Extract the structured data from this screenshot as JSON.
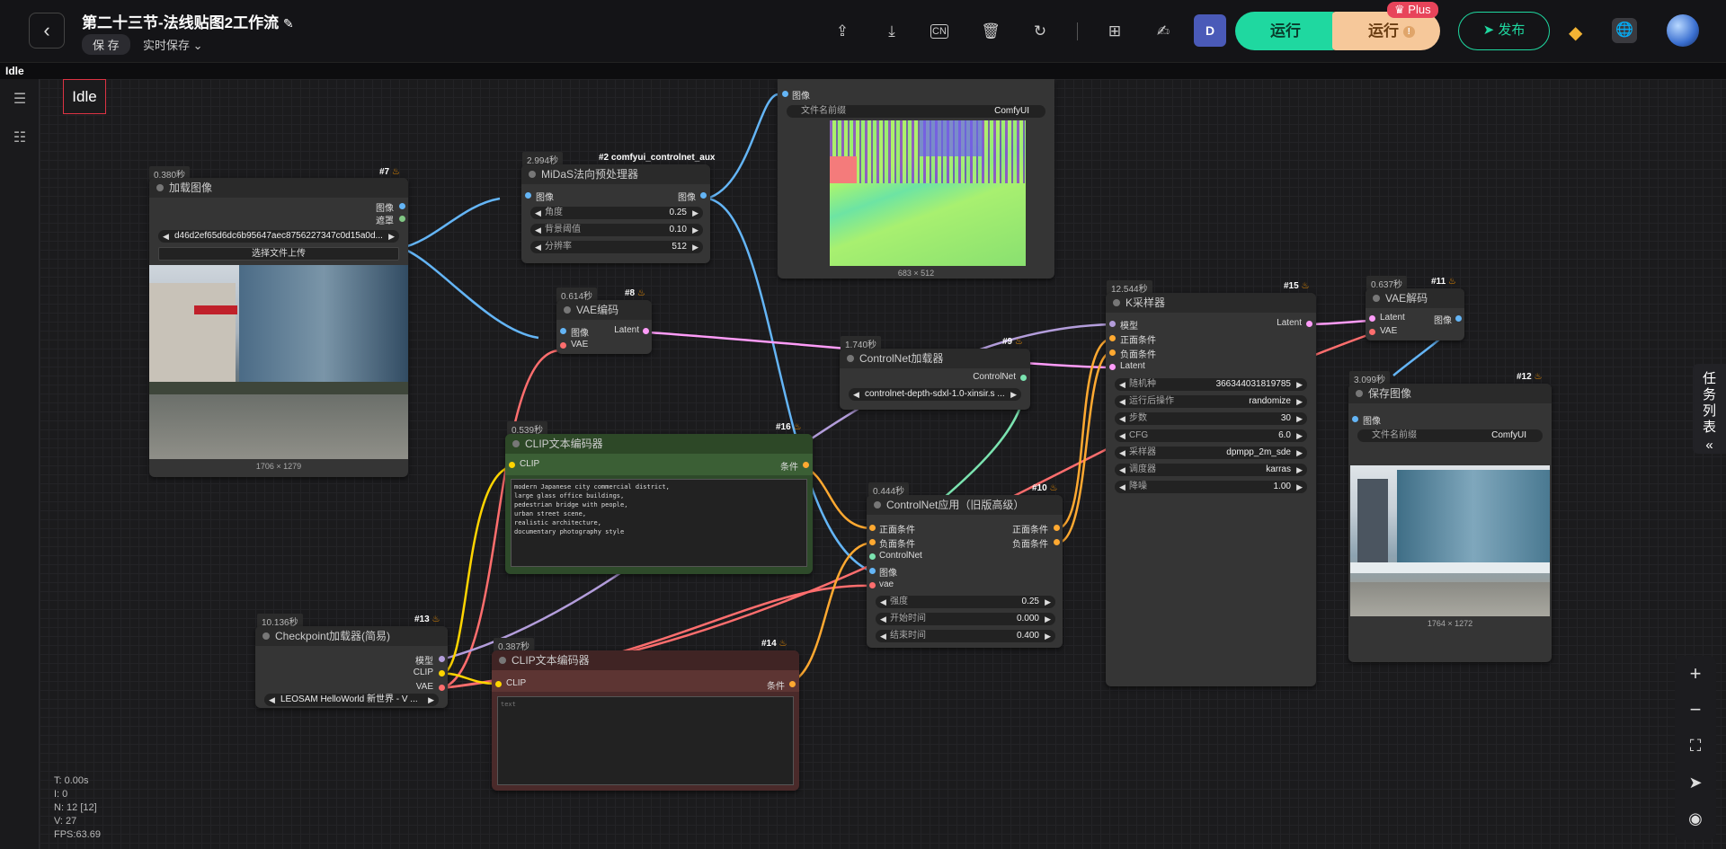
{
  "topbar": {
    "back_icon": "chevron-left-icon",
    "title": "第二十三节-法线贴图2工作流",
    "save_label": "保 存",
    "autosave_label": "实时保存",
    "run_label": "运行",
    "run_plus_label": "运行",
    "plus_badge": "Plus",
    "publish_label": "发布",
    "discord_label": "D"
  },
  "status_label": "Idle",
  "idle_box": "Idle",
  "right_tab": {
    "label": "任务列表",
    "icon": "double-chevron-left-icon"
  },
  "stats": {
    "t": "T: 0.00s",
    "i": "I: 0",
    "n": "N: 12 [12]",
    "v": "V: 27",
    "fps": "FPS:63.69"
  },
  "nodes": {
    "load_image": {
      "time": "0.380秒",
      "id": "#7",
      "title": "加载图像",
      "out_image": "图像",
      "out_mask": "遮罩",
      "filename": "d46d2ef65d6dc6b95647aec8756227347c0d15a0d...",
      "upload": "选择文件上传",
      "caption": "1706 × 1279"
    },
    "midas": {
      "time": "2.994秒",
      "id": "#2 comfyui_controlnet_aux",
      "title": "MiDaS法向预处理器",
      "in_image": "图像",
      "out_image": "图像",
      "widgets": [
        {
          "label": "角度",
          "value": "0.25"
        },
        {
          "label": "背景阈值",
          "value": "0.10"
        },
        {
          "label": "分辨率",
          "value": "512"
        }
      ]
    },
    "preview": {
      "in_image": "图像",
      "prefix_label": "文件名前缀",
      "prefix_value": "ComfyUI",
      "caption": "683 × 512"
    },
    "vae_encode": {
      "time": "0.614秒",
      "id": "#8",
      "title": "VAE编码",
      "in_image": "图像",
      "in_vae": "VAE",
      "out_latent": "Latent"
    },
    "controlnet_loader": {
      "time": "1.740秒",
      "id": "#9",
      "title": "ControlNet加载器",
      "out": "ControlNet",
      "model": "controlnet-depth-sdxl-1.0-xinsir.s ..."
    },
    "clip_pos": {
      "time": "0.539秒",
      "id": "#16",
      "title": "CLIP文本编码器",
      "in_clip": "CLIP",
      "out": "条件",
      "text": "modern Japanese city commercial district,\nlarge glass office buildings,\npedestrian bridge with people,\nurban street scene,\nrealistic architecture,\ndocumentary photography style"
    },
    "checkpoint": {
      "time": "10.136秒",
      "id": "#13",
      "title": "Checkpoint加载器(简易)",
      "out_model": "模型",
      "out_clip": "CLIP",
      "out_vae": "VAE",
      "ckpt": "LEOSAM HelloWorld 新世界 - V ..."
    },
    "clip_neg": {
      "time": "0.387秒",
      "id": "#14",
      "title": "CLIP文本编码器",
      "in_clip": "CLIP",
      "out": "条件",
      "text": "text"
    },
    "controlnet_apply": {
      "time": "0.444秒",
      "id": "#10",
      "title": "ControlNet应用（旧版高级）",
      "in_pos": "正面条件",
      "in_neg": "负面条件",
      "in_cn": "ControlNet",
      "in_image": "图像",
      "in_vae": "vae",
      "out_pos": "正面条件",
      "out_neg": "负面条件",
      "widgets": [
        {
          "label": "强度",
          "value": "0.25"
        },
        {
          "label": "开始时间",
          "value": "0.000"
        },
        {
          "label": "结束时间",
          "value": "0.400"
        }
      ]
    },
    "ksampler": {
      "time": "12.544秒",
      "id": "#15",
      "title": "K采样器",
      "in_model": "模型",
      "in_pos": "正面条件",
      "in_neg": "负面条件",
      "in_latent": "Latent",
      "out_latent": "Latent",
      "widgets": [
        {
          "label": "随机种",
          "value": "366344031819785"
        },
        {
          "label": "运行后操作",
          "value": "randomize"
        },
        {
          "label": "步数",
          "value": "30"
        },
        {
          "label": "CFG",
          "value": "6.0"
        },
        {
          "label": "采样器",
          "value": "dpmpp_2m_sde"
        },
        {
          "label": "调度器",
          "value": "karras"
        },
        {
          "label": "降噪",
          "value": "1.00"
        }
      ]
    },
    "vae_decode": {
      "time": "0.637秒",
      "id": "#11",
      "title": "VAE解码",
      "in_latent": "Latent",
      "in_vae": "VAE",
      "out_image": "图像"
    },
    "save_image": {
      "time": "3.099秒",
      "id": "#12",
      "title": "保存图像",
      "in_image": "图像",
      "prefix_label": "文件名前缀",
      "prefix_value": "ComfyUI",
      "caption": "1764 × 1272"
    }
  },
  "colors": {
    "image": "#64b5f6",
    "vae": "#ff6e6e",
    "latent": "#ff9cf9",
    "clip": "#ffd500",
    "model": "#b39ddb",
    "cond": "#ffa931",
    "controlnet": "#7be3b0",
    "mask": "#81c784",
    "accent": "#1fd8a0"
  }
}
